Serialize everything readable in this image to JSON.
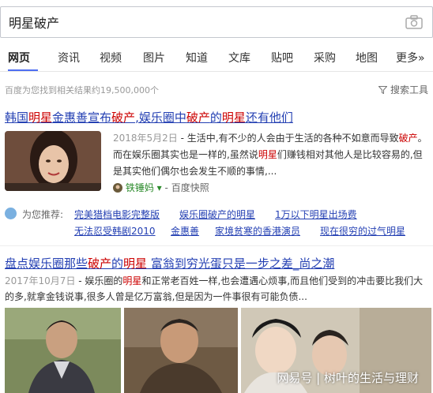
{
  "search": {
    "query": "明星破产",
    "camera_icon": "camera-icon"
  },
  "nav": {
    "items": [
      "网页",
      "资讯",
      "视频",
      "图片",
      "知道",
      "文库",
      "贴吧",
      "采购",
      "地图",
      "更多»"
    ],
    "active": "网页"
  },
  "results_count": "百度为您找到相关结果约19,500,000个",
  "tools_label": "搜索工具",
  "result1": {
    "title": "韩国明星金惠善宣布破产,娱乐圈中破产的明星还有他们",
    "date": "2018年5月2日",
    "snippet": " - 生活中,有不少的人会由于生活的各种不如意而导致破产。而在娱乐圈其实也是一样的,虽然说明星们赚钱相对其他人是比较容易的,但是其实他们偶尔也会发生不顺的事情,...",
    "source": "铁锤妈",
    "snapshot": "百度快照"
  },
  "suggestions": {
    "label": "为您推荐:",
    "items": [
      "完美猎档电影完整版",
      "娱乐圈破产的明星",
      "1万以下明星出场费",
      "无法忍受韩剧2010",
      "金惠善",
      "家境贫寒的香港演员",
      "现在很穷的过气明星"
    ]
  },
  "result2": {
    "title": "盘点娱乐圈那些破产的明星 富翁到穷光蛋只是一步之差_尚之潮",
    "date": "2017年10月7日",
    "snippet": " - 娱乐圈的明星和正常老百姓一样,也会遭遇心烦事,而且他们受到的冲击要比我们大的多,就拿金钱说事,很多人曾是亿万富翁,但是因为一件事很有可能负债..."
  },
  "watermark": "网易号 | 树叶的生活与理财"
}
